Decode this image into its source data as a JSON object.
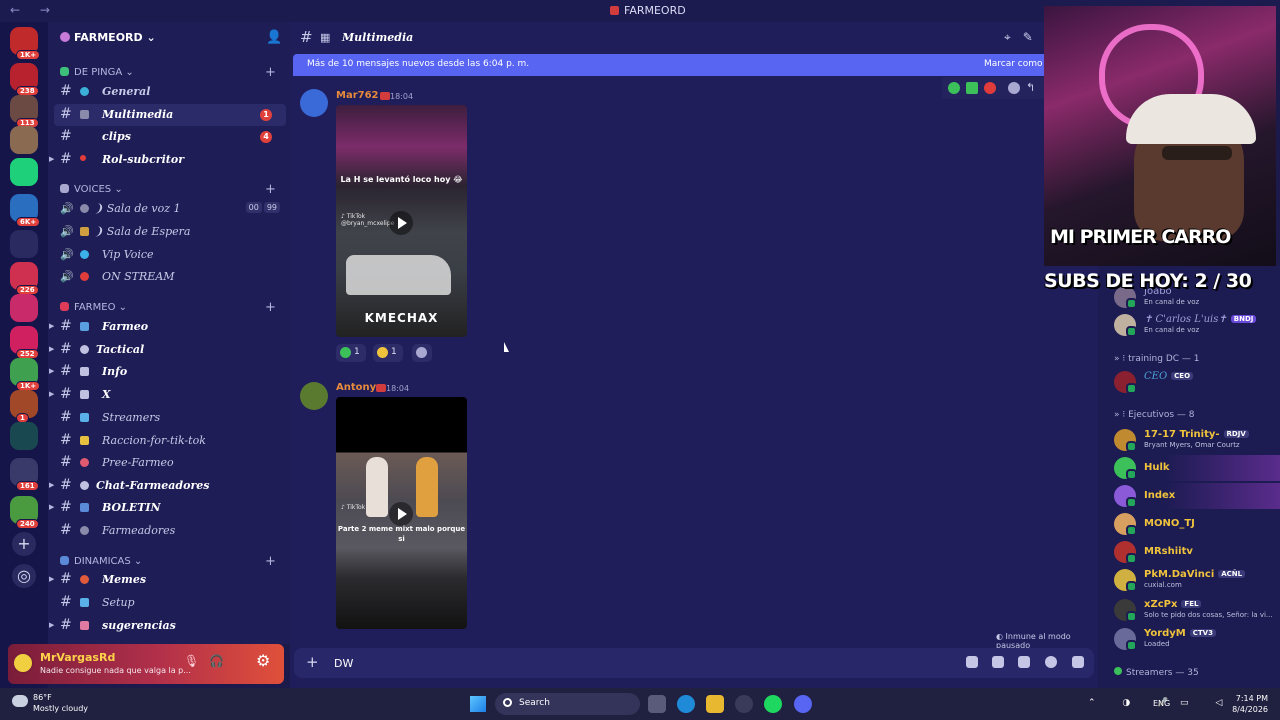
{
  "window": {
    "title": "FARMEORD",
    "nav": "← →"
  },
  "guild": {
    "name": "FARMEORD ⌄"
  },
  "categories": [
    {
      "label": "DE PINGA ⌄",
      "plus": "+"
    },
    {
      "label": "VOICES ⌄",
      "plus": "+"
    },
    {
      "label": "FARMEO ⌄",
      "plus": "+"
    },
    {
      "label": "DINAMICAS ⌄",
      "plus": "+"
    }
  ],
  "channels": [
    {
      "label": "General"
    },
    {
      "label": "Multimedia",
      "count": "1"
    },
    {
      "label": "clips",
      "count": "4"
    },
    {
      "label": "Rol-subcritor"
    },
    {
      "label": "❩ Sala de voz 1",
      "vcount_a": "00",
      "vcount_b": "99"
    },
    {
      "label": "❩ Sala de Espera"
    },
    {
      "label": "Vip Voice"
    },
    {
      "label": "ON STREAM"
    },
    {
      "label": "Farmeo"
    },
    {
      "label": "Tactical"
    },
    {
      "label": "Info"
    },
    {
      "label": "X"
    },
    {
      "label": "Streamers"
    },
    {
      "label": "Raccion-for-tik-tok"
    },
    {
      "label": "Pree-Farmeo"
    },
    {
      "label": "Chat-Farmeadores"
    },
    {
      "label": "BOLETIN"
    },
    {
      "label": "Farmeadores"
    },
    {
      "label": "Memes"
    },
    {
      "label": "Setup"
    },
    {
      "label": "sugerencias"
    }
  ],
  "server_badges": [
    "1K+",
    "238",
    "113",
    "6K+",
    "226",
    "252",
    "1K+",
    "1",
    "161",
    "240"
  ],
  "user": {
    "name": "MrVargasRd",
    "status": "Nadie consigue nada que valga la p..."
  },
  "header": {
    "channel": "Multimedia"
  },
  "newbar": {
    "text": "Más de 10 mensajes nuevos desde las 6:04 p. m.",
    "mark": "Marcar como l"
  },
  "messages": [
    {
      "author": "Mar762",
      "time": "18:04",
      "video_caption": "La H se levantó loco hoy 😂",
      "video_tiktok": "♪ TikTok",
      "video_handle": "@bryan_mcxelipe",
      "video_brand": "KMECHAX",
      "reactions": [
        {
          "count": "1"
        },
        {
          "count": "1"
        }
      ]
    },
    {
      "author": "Antony",
      "time": "18:04",
      "video_caption": "Parte 2 meme mixt malo porque si",
      "video_tiktok": "♪ TikTok"
    }
  ],
  "paused": "Inmune al modo pausado",
  "composer": {
    "value": "DW"
  },
  "members": {
    "groups": [
      "» ⁝ training DC — 1",
      "» ⁝ Ejecutivos — 8",
      "Streamers — 35"
    ],
    "list": [
      {
        "name": "Joabo",
        "status": "En canal de voz",
        "color": "#9f9fd8"
      },
      {
        "name": "✝ C'arlos L'uis✝",
        "tag": "BNDJ",
        "status": "En canal de voz",
        "color": "#9f9fd8"
      },
      {
        "name": "CEO",
        "tag": "CEO",
        "color": "#4fa3d8"
      },
      {
        "name": "17-17 Trinity-",
        "tag": "RDJV",
        "status": "Bryant Myers, Omar Courtz",
        "color": "#f0c33c"
      },
      {
        "name": "Hulk",
        "color": "#f0c33c"
      },
      {
        "name": "Index",
        "color": "#f0c33c"
      },
      {
        "name": "MONO_TJ",
        "color": "#f0c33c"
      },
      {
        "name": "MRshiitv",
        "color": "#f0c33c"
      },
      {
        "name": "PkM.DaVinci",
        "tag": "ACÑL",
        "status": "cuxial.com",
        "color": "#f0c33c"
      },
      {
        "name": "xZcPx",
        "tag": "FEL",
        "status": "Solo te pido dos cosas, Señor: la vi...",
        "color": "#f0c33c"
      },
      {
        "name": "YordyM",
        "tag": "CTV3",
        "status": "Loaded",
        "color": "#f0c33c"
      }
    ]
  },
  "stream": {
    "overlay": "MI PRIMER CARRO",
    "subs": "SUBS DE HOY: 2 / 30"
  },
  "taskbar": {
    "temp": "86°F",
    "weather": "Mostly cloudy",
    "search": "Search",
    "lang": "ENG",
    "time": "7:14 PM",
    "date": "8/4/2026"
  },
  "colors": {
    "accent": "#5865f2",
    "author": "#e68a3c",
    "unread": "#e0403c"
  }
}
